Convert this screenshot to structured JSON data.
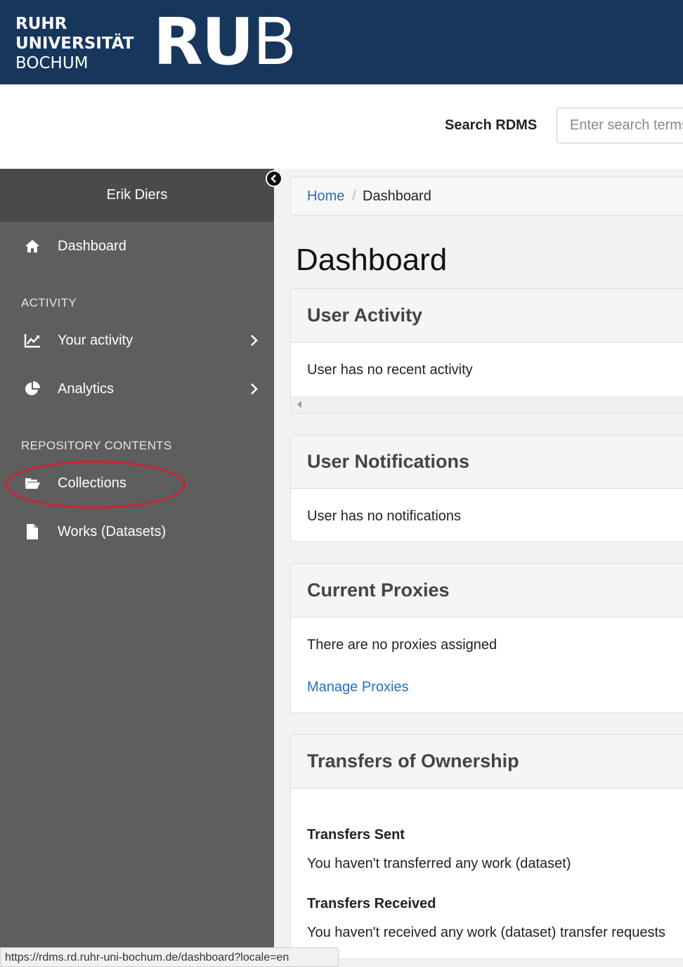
{
  "brand": {
    "line1": "RUHR",
    "line2": "UNIVERSITÄT",
    "line3": "BOCHUM",
    "logo_bold": "RU",
    "logo_light": "B"
  },
  "search": {
    "label": "Search RDMS",
    "placeholder": "Enter search terms"
  },
  "sidebar": {
    "user_name": "Erik Diers",
    "dashboard_label": "Dashboard",
    "activity_heading": "ACTIVITY",
    "your_activity_label": "Your activity",
    "analytics_label": "Analytics",
    "repository_heading": "REPOSITORY CONTENTS",
    "collections_label": "Collections",
    "works_label": "Works (Datasets)"
  },
  "breadcrumb": {
    "home": "Home",
    "separator": "/",
    "current": "Dashboard"
  },
  "main": {
    "title": "Dashboard",
    "user_activity": {
      "title": "User Activity",
      "text": "User has no recent activity"
    },
    "user_notifications": {
      "title": "User Notifications",
      "text": "User has no notifications"
    },
    "current_proxies": {
      "title": "Current Proxies",
      "text": "There are no proxies assigned",
      "link": "Manage Proxies"
    },
    "transfers": {
      "title": "Transfers of Ownership",
      "sent_heading": "Transfers Sent",
      "sent_text": "You haven't transferred any work (dataset)",
      "received_heading": "Transfers Received",
      "received_text": "You haven't received any work (dataset) transfer requests"
    }
  },
  "status_url": "https://rdms.rd.ruhr-uni-bochum.de/dashboard?locale=en",
  "colors": {
    "brand_blue": "#17365c",
    "sidebar_bg": "#5e5e5e",
    "highlight_circle": "#d1222e",
    "link": "#2a6ebb"
  }
}
